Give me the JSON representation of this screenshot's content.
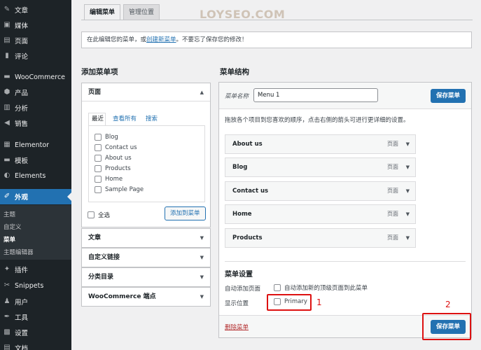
{
  "sidebar": {
    "items": [
      {
        "label": "文章",
        "icon": "pin-icon",
        "glyph": "✎"
      },
      {
        "label": "媒体",
        "icon": "media-icon",
        "glyph": "▣"
      },
      {
        "label": "页面",
        "icon": "page-icon",
        "glyph": "▤"
      },
      {
        "label": "评论",
        "icon": "comment-icon",
        "glyph": "▮"
      },
      {
        "label": "WooCommerce",
        "icon": "woocommerce-icon",
        "glyph": "▬"
      },
      {
        "label": "产品",
        "icon": "product-icon",
        "glyph": "⬢"
      },
      {
        "label": "分析",
        "icon": "analytics-icon",
        "glyph": "▥"
      },
      {
        "label": "销售",
        "icon": "megaphone-icon",
        "glyph": "◀"
      },
      {
        "label": "Elementor",
        "icon": "elementor-icon",
        "glyph": "▦"
      },
      {
        "label": "模板",
        "icon": "folder-icon",
        "glyph": "▬"
      },
      {
        "label": "Elements",
        "icon": "elements-icon",
        "glyph": "◐"
      },
      {
        "label": "外观",
        "icon": "appearance-icon",
        "glyph": "✐"
      },
      {
        "label": "插件",
        "icon": "plugin-icon",
        "glyph": "✦"
      },
      {
        "label": "Snippets",
        "icon": "snippets-icon",
        "glyph": "✂"
      },
      {
        "label": "用户",
        "icon": "users-icon",
        "glyph": "♟"
      },
      {
        "label": "工具",
        "icon": "tools-icon",
        "glyph": "✒"
      },
      {
        "label": "设置",
        "icon": "settings-icon",
        "glyph": "▩"
      },
      {
        "label": "文档",
        "icon": "docs-icon",
        "glyph": "▤"
      }
    ],
    "submenu": [
      "主题",
      "自定义",
      "菜单",
      "主题编辑器"
    ]
  },
  "tabs": [
    "编辑菜单",
    "管理位置"
  ],
  "watermark": "LOYSEO.COM",
  "notice": {
    "before": "在此编辑您的菜单，或",
    "link": "创建新菜单",
    "after": "。不要忘了保存您的修改！"
  },
  "add_items": {
    "title": "添加菜单项",
    "pages_panel": {
      "title": "页面",
      "subtabs": [
        "最近",
        "查看所有",
        "搜索"
      ],
      "pages": [
        "Blog",
        "Contact us",
        "About us",
        "Products",
        "Home",
        "Sample Page"
      ],
      "select_all": "全选",
      "add_button": "添加到菜单"
    },
    "other_panels": [
      "文章",
      "自定义链接",
      "分类目录",
      "WooCommerce 端点"
    ]
  },
  "structure": {
    "title": "菜单结构",
    "name_label": "菜单名称",
    "name_value": "Menu 1",
    "save_label": "保存菜单",
    "instructions": "拖放各个项目到您喜欢的顺序，点击右侧的箭头可进行更详细的设置。",
    "item_type": "页面",
    "items": [
      "About us",
      "Blog",
      "Contact us",
      "Home",
      "Products"
    ],
    "settings": {
      "title": "菜单设置",
      "auto_add_label": "自动添加页面",
      "auto_add_option": "自动添加新的顶级页面到此菜单",
      "location_label": "显示位置",
      "location_option": "Primary"
    },
    "delete_label": "删除菜单"
  },
  "annotations": [
    "1",
    "2"
  ],
  "colors": {
    "accent": "#2271b1",
    "sidebar_bg": "#1d2327",
    "highlight_red": "#dd1111"
  }
}
